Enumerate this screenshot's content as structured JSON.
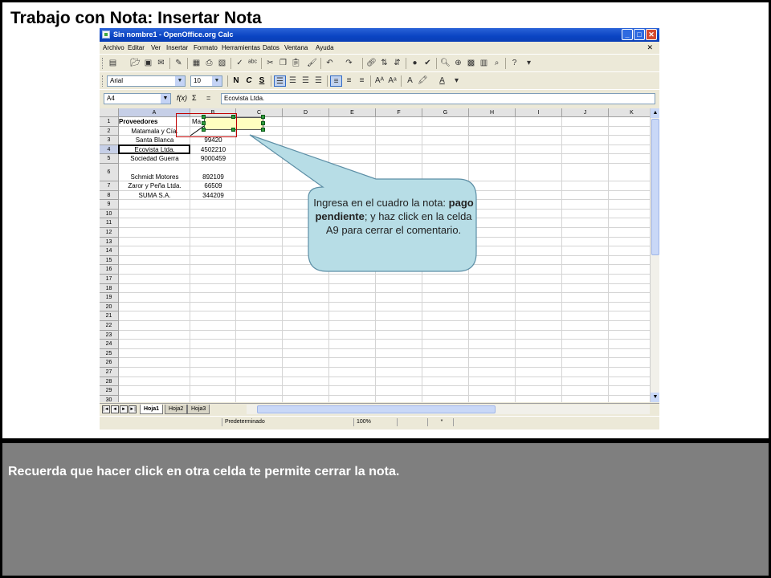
{
  "slide": {
    "title": "Trabajo con Nota: Insertar Nota",
    "bottom_note": "Recuerda que hacer click en otra celda te permite cerrar la nota."
  },
  "window": {
    "title": "Sin nombre1 - OpenOffice.org Calc",
    "buttons": {
      "minimize": "_",
      "maximize": "□",
      "close": "✕"
    }
  },
  "menu": [
    "Archivo",
    "Editar",
    "Ver",
    "Insertar",
    "Formato",
    "Herramientas",
    "Datos",
    "Ventana",
    "Ayuda"
  ],
  "menu_close": "✕",
  "format_bar": {
    "font_name": "Arial",
    "font_size": "10",
    "bold": "N",
    "italic": "C",
    "underline": "S"
  },
  "formula_bar": {
    "cell_ref": "A4",
    "fx": "f(x)",
    "sum": "Σ",
    "equals": "=",
    "content": "Ecovista Ltda."
  },
  "sheet": {
    "columns": [
      "A",
      "B",
      "C",
      "D",
      "E",
      "F",
      "G",
      "H",
      "I",
      "J",
      "K"
    ],
    "rows": [
      "1",
      "2",
      "3",
      "4",
      "5",
      "6",
      "7",
      "8",
      "9",
      "10",
      "11",
      "12",
      "13",
      "14",
      "15",
      "16",
      "17",
      "18",
      "19",
      "20",
      "21",
      "22",
      "23",
      "24",
      "25",
      "26",
      "27",
      "28",
      "29",
      "30"
    ],
    "header_a": "Proveedores",
    "header_b": "Ma",
    "providers": [
      "Matamala y Cía.",
      "Santa Blanca",
      "Ecovista Ltda.",
      "Sociedad Guerra",
      "Schmidt Motores",
      "Zaror y Peña Ltda.",
      "SUMA S.A."
    ],
    "amounts": [
      "99420",
      "4502210",
      "9000459",
      "892109",
      "66509",
      "344209"
    ]
  },
  "tabs": [
    "Hoja1",
    "Hoja2",
    "Hoja3"
  ],
  "tab_nav": [
    "|◄",
    "◄",
    "►",
    "►|"
  ],
  "status": {
    "style": "Predeterminado",
    "zoom": "100%",
    "mode": "*"
  },
  "callout": {
    "text_before": "Ingresa en el cuadro la nota: ",
    "text_bold": "pago pendiente",
    "text_after": "; y haz click en la celda A9 para cerrar el comentario."
  },
  "colors": {
    "callout_fill": "#b7dde6",
    "note_fill": "#ffffc0",
    "frame_red": "#c00000",
    "titlebar_blue": "#0a44c2",
    "bottom_panel": "#7f7f7f"
  }
}
